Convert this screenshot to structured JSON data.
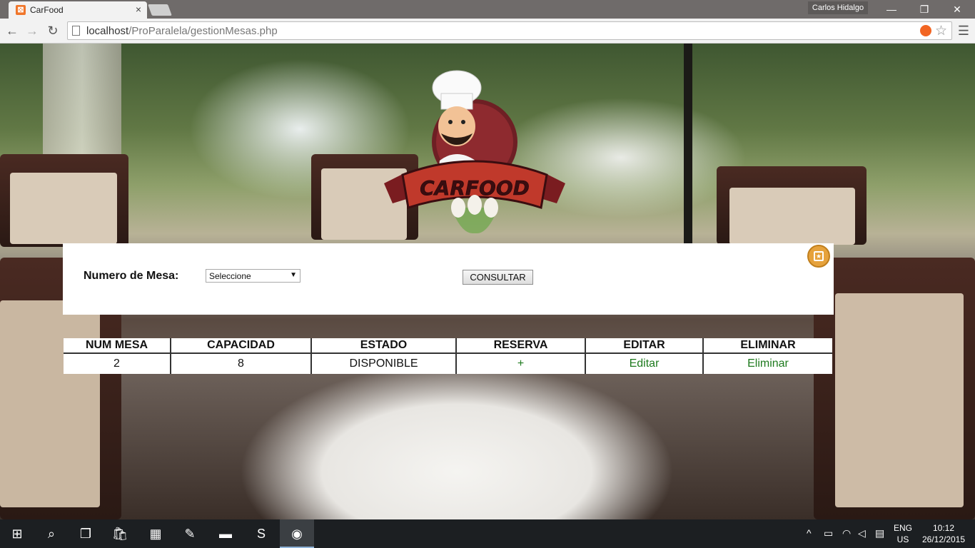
{
  "browser": {
    "tab_title": "CarFood",
    "tab_close": "×",
    "user_name": "Carlos Hidalgo",
    "url_host": "localhost",
    "url_path": "/ProParalela/gestionMesas.php",
    "window_controls": {
      "minimize": "—",
      "restore": "❐",
      "close": "✕"
    }
  },
  "logo": {
    "text": "CARFOOD",
    "icon": "chef-logo-icon"
  },
  "form": {
    "label": "Numero de Mesa:",
    "select_value": "Seleccione",
    "button_label": "CONSULTAR",
    "fav_icon": "star-box-icon"
  },
  "table": {
    "headers": [
      "NUM MESA",
      "CAPACIDAD",
      "ESTADO",
      "RESERVA",
      "EDITAR",
      "ELIMINAR"
    ],
    "rows": [
      {
        "num_mesa": "2",
        "capacidad": "8",
        "estado": "DISPONIBLE",
        "reserva": "+",
        "editar": "Editar",
        "eliminar": "Eliminar"
      }
    ]
  },
  "taskbar": {
    "lang_top": "ENG",
    "lang_bottom": "US",
    "time": "10:12",
    "date": "26/12/2015"
  },
  "colors": {
    "link": "#1e7a1e",
    "fav_button": "#e6a23c",
    "logo_ribbon": "#c0392b"
  }
}
